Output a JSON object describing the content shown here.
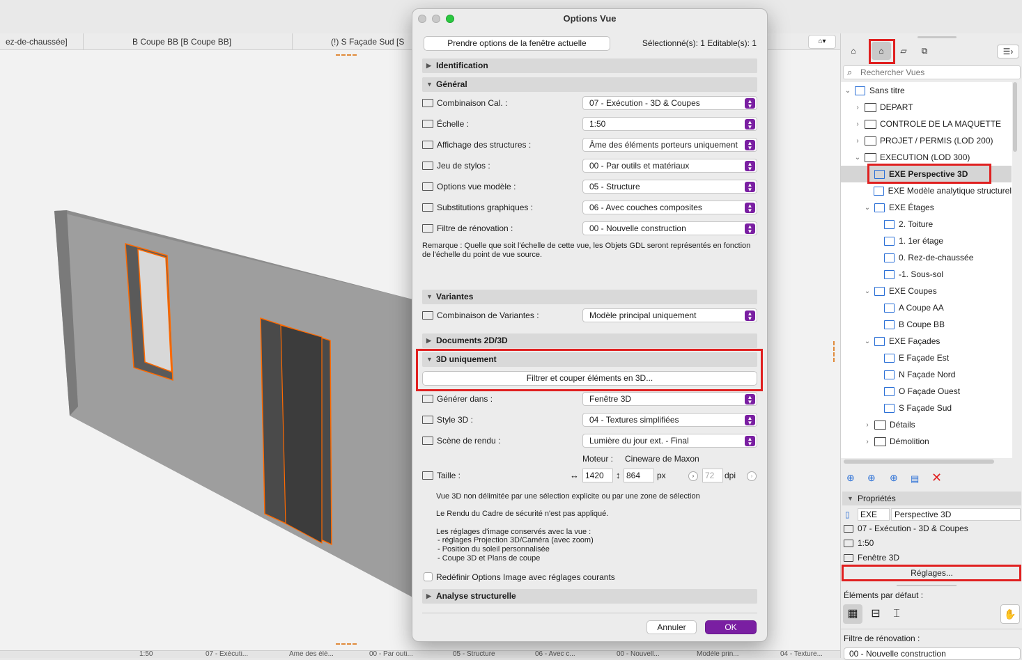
{
  "viewport_tabs": [
    "ez-de-chaussée]",
    "B Coupe BB [B Coupe BB]",
    "(!) S Façade Sud [S"
  ],
  "statusbar_items": [
    "1:50",
    "07 - Exécuti...",
    "Âme des élé...",
    "00 - Par outi...",
    "05 - Structure",
    "06 - Avec c...",
    "00 - Nouvell...",
    "Modèle prin...",
    "04 - Texture..."
  ],
  "dialog": {
    "title": "Options Vue",
    "take_options_button": "Prendre options de la fenêtre actuelle",
    "selection_info": "Sélectionné(s): 1 Editable(s): 1",
    "sections": {
      "identification": "Identification",
      "general": "Général",
      "variantes": "Variantes",
      "documents": "Documents 2D/3D",
      "only3d": "3D uniquement",
      "analyse": "Analyse structurelle"
    },
    "general_rows": [
      {
        "label": "Combinaison Cal. :",
        "value": "07 - Exécution - 3D & Coupes"
      },
      {
        "label": "Échelle :",
        "value": "1:50"
      },
      {
        "label": "Affichage des structures :",
        "value": "Âme des éléments porteurs uniquement"
      },
      {
        "label": "Jeu de stylos :",
        "value": "00 - Par outils et matériaux"
      },
      {
        "label": "Options vue modèle :",
        "value": "05 - Structure"
      },
      {
        "label": "Substitutions graphiques :",
        "value": "06 - Avec couches composites"
      },
      {
        "label": "Filtre de rénovation :",
        "value": "00 - Nouvelle construction"
      }
    ],
    "remark": "Remarque : Quelle que soit l'échelle de cette vue, les Objets GDL seront représentés en fonction de l'échelle du point de vue source.",
    "variant_row": {
      "label": "Combinaison de Variantes :",
      "value": "Modèle principal uniquement"
    },
    "filter_button": "Filtrer et couper éléments en 3D...",
    "rows_3d": [
      {
        "label": "Générer dans :",
        "value": "Fenêtre 3D"
      },
      {
        "label": "Style 3D :",
        "value": "04 - Textures simplifiées"
      },
      {
        "label": "Scène de rendu :",
        "value": "Lumière du jour ext. - Final"
      }
    ],
    "engine_label": "Moteur :",
    "engine_value": "Cineware de Maxon",
    "size_label": "Taille :",
    "width": "1420",
    "height": "864",
    "unit_px": "px",
    "dpi_value": "72",
    "unit_dpi": "dpi",
    "info1": "Vue 3D non délimitée par une sélection explicite ou par une zone de sélection",
    "info2": "Le Rendu du Cadre de sécurité n'est pas appliqué.",
    "info3_title": "Les réglages d'image conservés avec la vue :",
    "info3_items": [
      "- réglages Projection 3D/Caméra (avec zoom)",
      "- Position du soleil personnalisée",
      "- Coupe 3D et Plans de coupe"
    ],
    "redefine_checkbox": "Redéfinir Options Image avec réglages courants",
    "cancel": "Annuler",
    "ok": "OK"
  },
  "navigator": {
    "search_placeholder": "Rechercher Vues",
    "root": "Sans titre",
    "tree": [
      {
        "label": "DEPART",
        "type": "folder",
        "level": 1,
        "expanded": false
      },
      {
        "label": "CONTROLE DE LA MAQUETTE",
        "type": "folder",
        "level": 1,
        "expanded": false
      },
      {
        "label": "PROJET / PERMIS (LOD 200)",
        "type": "folder",
        "level": 1,
        "expanded": false
      },
      {
        "label": "EXECUTION (LOD 300)",
        "type": "folder",
        "level": 1,
        "expanded": true
      },
      {
        "label": "EXE Perspective 3D",
        "type": "view",
        "level": 2,
        "selected": true
      },
      {
        "label": "EXE Modèle analytique structurel",
        "type": "view",
        "level": 2
      },
      {
        "label": "EXE Étages",
        "type": "group",
        "level": 2,
        "expanded": true
      },
      {
        "label": "2. Toiture",
        "type": "view",
        "level": 3
      },
      {
        "label": "1. 1er étage",
        "type": "view",
        "level": 3
      },
      {
        "label": "0. Rez-de-chaussée",
        "type": "view",
        "level": 3
      },
      {
        "label": "-1. Sous-sol",
        "type": "view",
        "level": 3
      },
      {
        "label": "EXE Coupes",
        "type": "group",
        "level": 2,
        "expanded": true
      },
      {
        "label": "A Coupe AA",
        "type": "view",
        "level": 3
      },
      {
        "label": "B Coupe BB",
        "type": "view",
        "level": 3
      },
      {
        "label": "EXE Façades",
        "type": "group",
        "level": 2,
        "expanded": true
      },
      {
        "label": "E Façade Est",
        "type": "view",
        "level": 3
      },
      {
        "label": "N Façade Nord",
        "type": "view",
        "level": 3
      },
      {
        "label": "O Façade Ouest",
        "type": "view",
        "level": 3
      },
      {
        "label": "S Façade Sud",
        "type": "view",
        "level": 3
      },
      {
        "label": "Détails",
        "type": "folder",
        "level": 2,
        "expanded": false
      },
      {
        "label": "Démolition",
        "type": "folder",
        "level": 2,
        "expanded": false
      }
    ],
    "properties_title": "Propriétés",
    "prop_id": "EXE",
    "prop_name": "Perspective 3D",
    "prop_rows": [
      "07 - Exécution - 3D & Coupes",
      "1:50",
      "Fenêtre 3D"
    ],
    "settings_button": "Réglages...",
    "default_elements": "Éléments par défaut :",
    "renovation_label": "Filtre de rénovation :",
    "renovation_value": "00 - Nouvelle construction"
  },
  "colors": {
    "accent": "#7a1fa2",
    "highlight_box": "#e02020",
    "wall_edge": "#ff6a00"
  }
}
